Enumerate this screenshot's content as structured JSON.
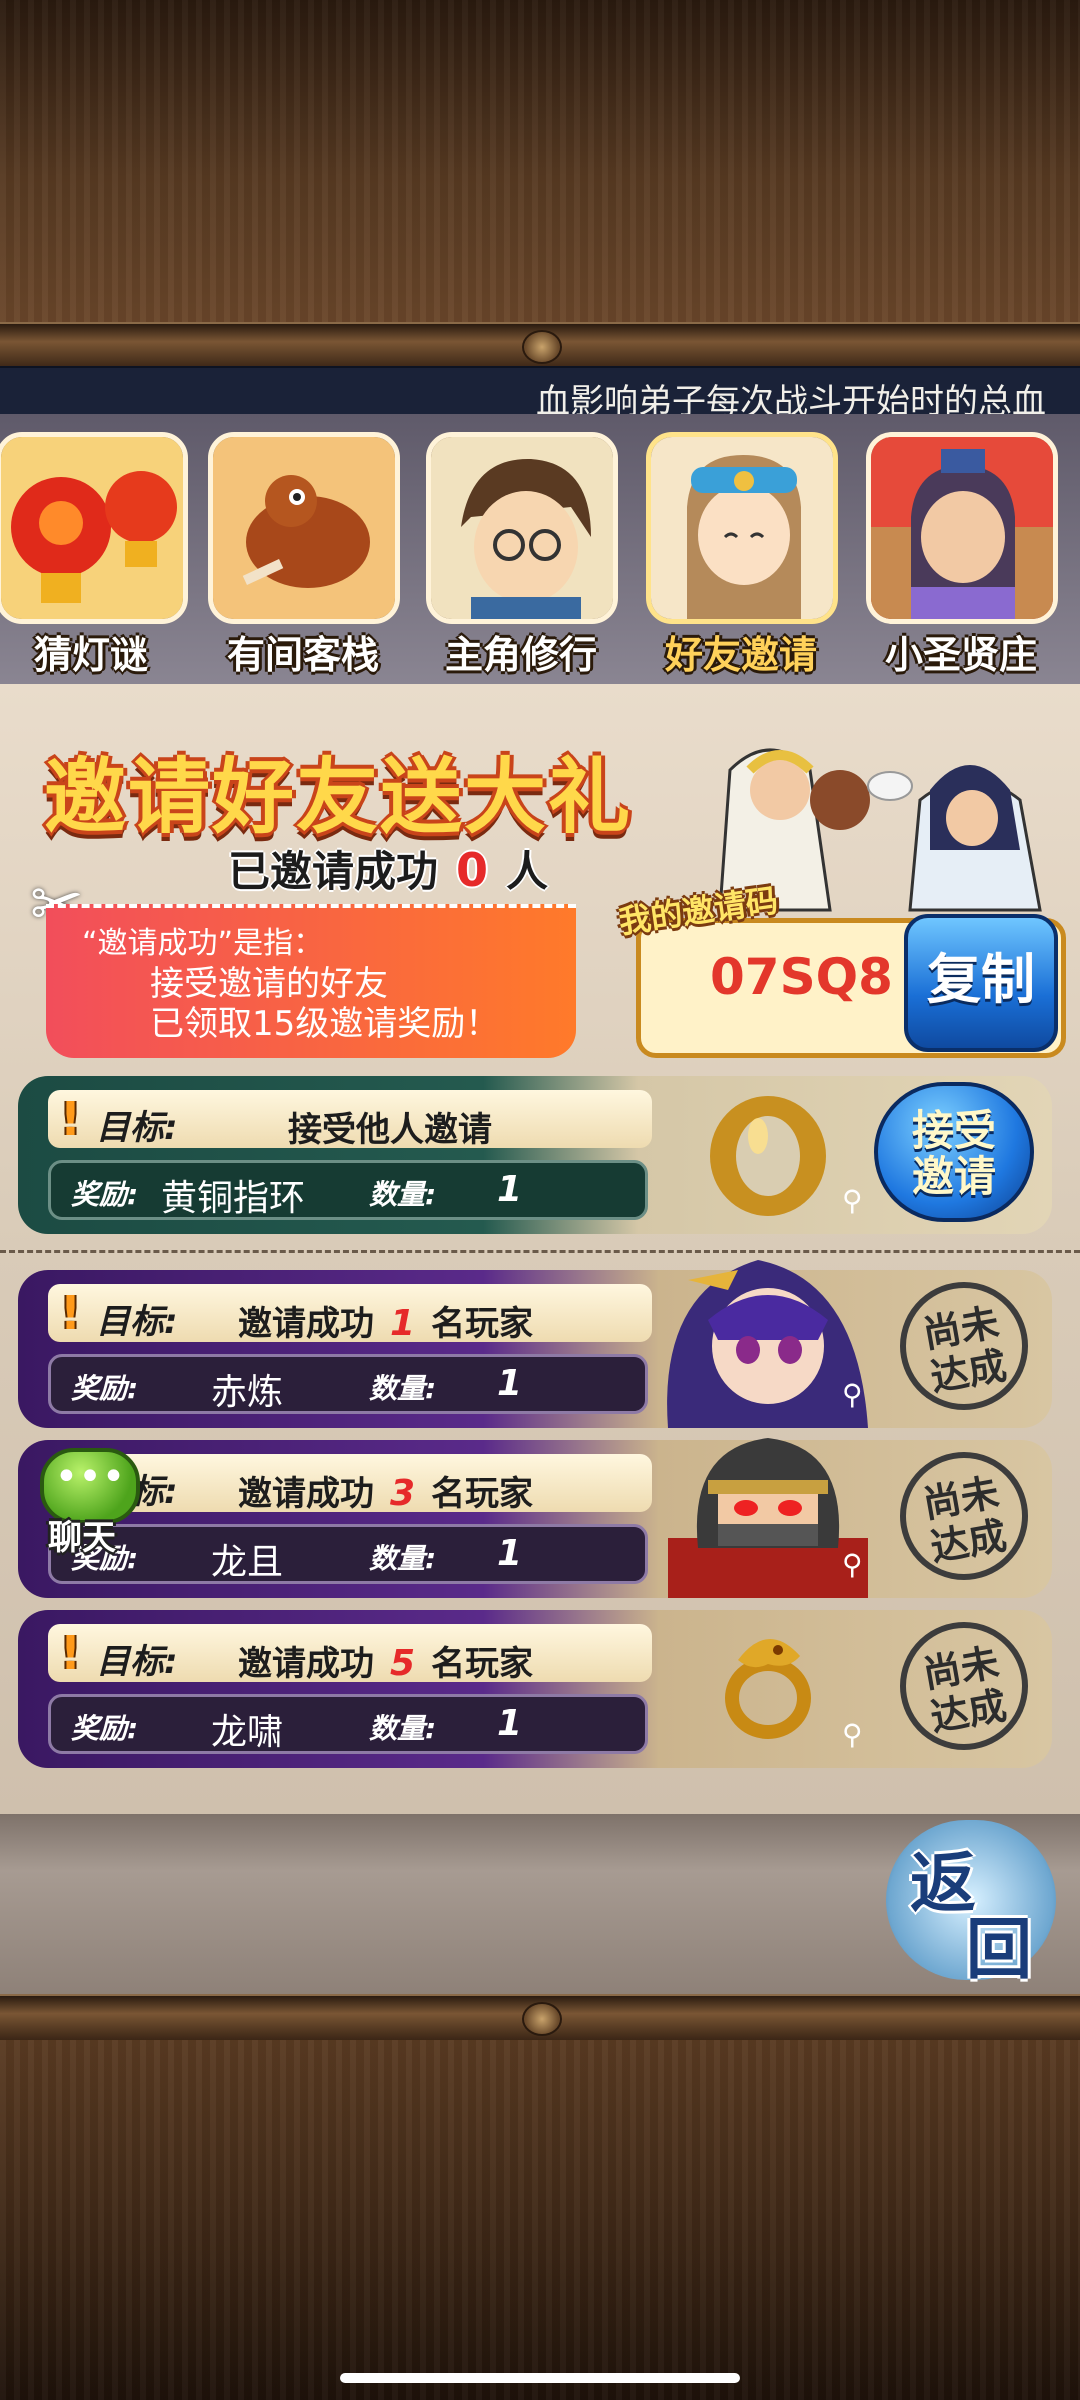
{
  "marquee": {
    "text": "血影响弟子每次战斗开始时的总血"
  },
  "tabs": [
    {
      "label": "猜灯谜",
      "icon": "lantern-icon"
    },
    {
      "label": "有间客栈",
      "icon": "roast-chicken-icon"
    },
    {
      "label": "主角修行",
      "icon": "hero-portrait-icon"
    },
    {
      "label": "好友邀请",
      "icon": "friend-invite-icon",
      "active": true
    },
    {
      "label": "小圣贤庄",
      "icon": "scholar-portrait-icon"
    }
  ],
  "invite": {
    "headline": "邀请好友送大礼",
    "success_prefix": "已邀请成功",
    "success_count": "0",
    "success_suffix": "人",
    "note_line1": "“邀请成功”是指：",
    "note_line2": "接受邀请的好友",
    "note_line3": "已领取15级邀请奖励！",
    "code_label": "我的邀请码",
    "code_value": "07SQ8",
    "copy_label": "复制"
  },
  "tasks": [
    {
      "goal_label": "目标:",
      "goal_text": "接受他人邀请",
      "reward_label": "奖励:",
      "reward_item": "黄铜指环",
      "qty_label": "数量:",
      "qty": "1",
      "action_label_1": "接受",
      "action_label_2": "邀请"
    },
    {
      "goal_label": "目标:",
      "goal_prefix": "邀请成功",
      "goal_count": "1",
      "goal_suffix": "名玩家",
      "reward_label": "奖励:",
      "reward_item": "赤炼",
      "qty_label": "数量:",
      "qty": "1",
      "status_1": "尚未",
      "status_2": "达成"
    },
    {
      "goal_label": "目标:",
      "goal_prefix": "邀请成功",
      "goal_count": "3",
      "goal_suffix": "名玩家",
      "reward_label": "奖励:",
      "reward_item": "龙且",
      "qty_label": "数量:",
      "qty": "1",
      "status_1": "尚未",
      "status_2": "达成"
    },
    {
      "goal_label": "目标:",
      "goal_prefix": "邀请成功",
      "goal_count": "5",
      "goal_suffix": "名玩家",
      "reward_label": "奖励:",
      "reward_item": "龙啸",
      "qty_label": "数量:",
      "qty": "1",
      "status_1": "尚未",
      "status_2": "达成"
    }
  ],
  "chat": {
    "label": "聊天",
    "dots": "•••"
  },
  "back": {
    "t1": "返",
    "t2": "回"
  },
  "colors": {
    "accent_gold": "#ffd84a",
    "count_red": "#e62a2a",
    "copy_blue": "#1a6fd6"
  }
}
